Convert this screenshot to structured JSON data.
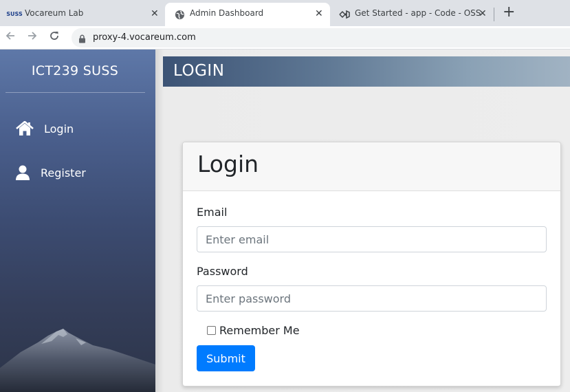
{
  "browser": {
    "tabs": [
      {
        "title": "Vocareum Lab",
        "icon": "suss-favicon",
        "favicon_text": "SUSS"
      },
      {
        "title": "Admin Dashboard",
        "icon": "globe-icon"
      },
      {
        "title": "Get Started - app - Code - OSS",
        "icon": "vscode-icon"
      }
    ],
    "close_glyph": "✕",
    "new_tab_glyph": "+",
    "url": "proxy-4.vocareum.com"
  },
  "sidebar": {
    "brand": "ICT239 SUSS",
    "items": [
      {
        "label": "Login",
        "icon": "home-icon"
      },
      {
        "label": "Register",
        "icon": "user-icon"
      }
    ]
  },
  "banner": {
    "title": "LOGIN"
  },
  "form": {
    "title": "Login",
    "email_label": "Email",
    "email_placeholder": "Enter email",
    "email_value": "",
    "password_label": "Password",
    "password_placeholder": "Enter password",
    "password_value": "",
    "remember_label": "Remember Me",
    "remember_checked": false,
    "submit_label": "Submit"
  },
  "colors": {
    "primary": "#007bff",
    "sidebar_top": "#5e78a8",
    "sidebar_bottom": "#2c3448"
  }
}
